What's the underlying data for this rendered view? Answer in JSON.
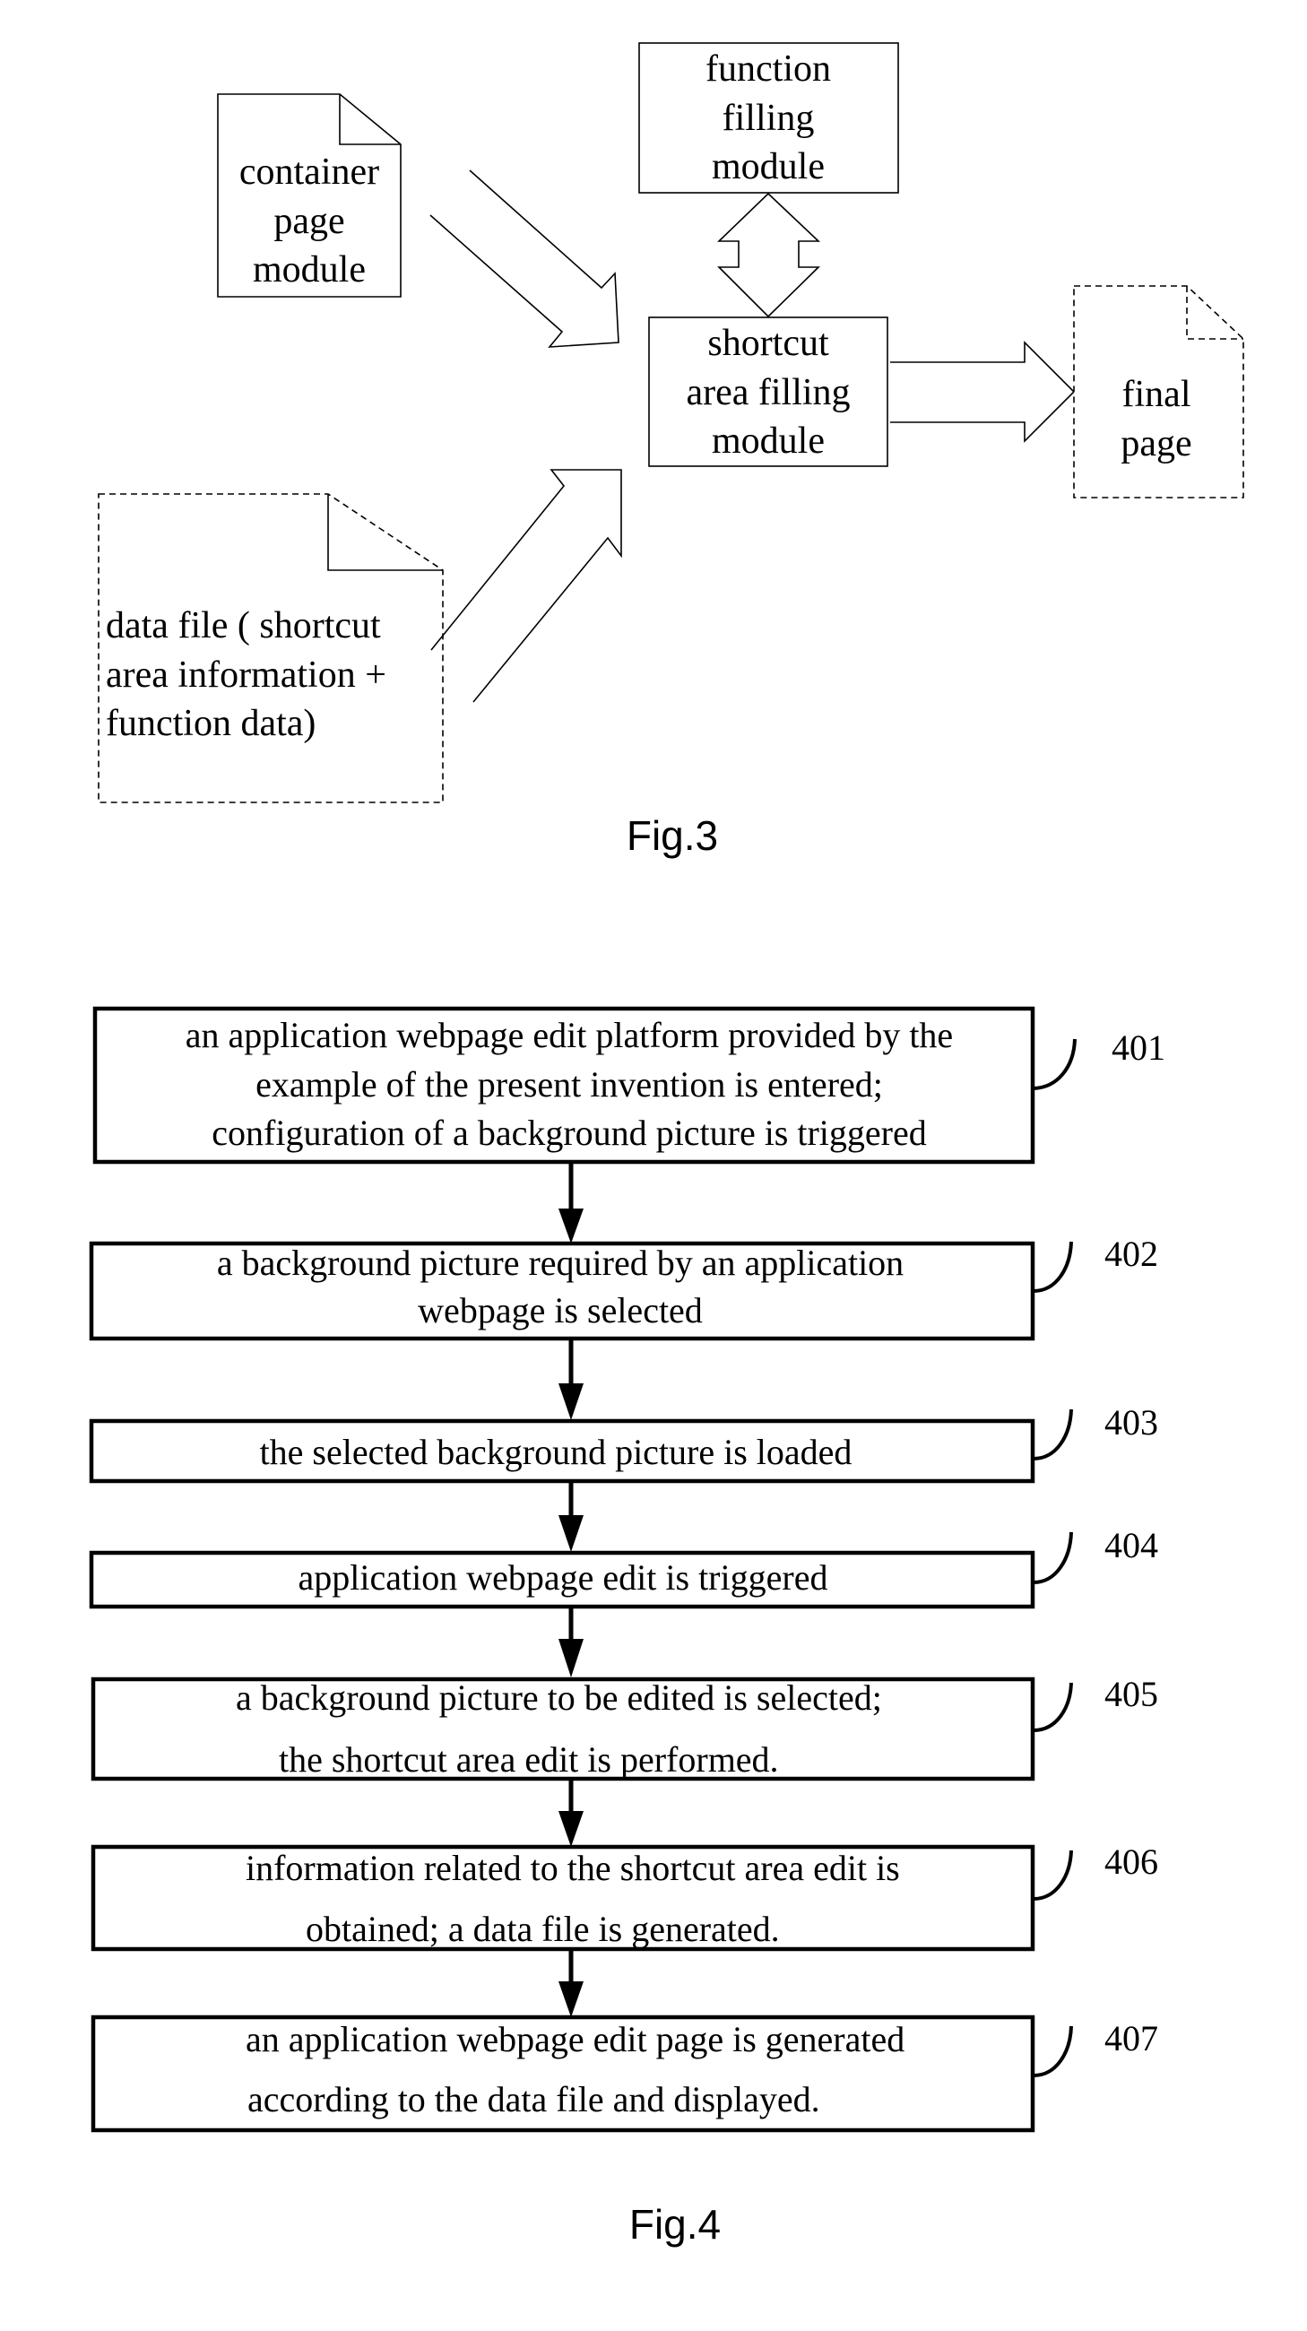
{
  "fig3": {
    "caption": "Fig.3",
    "nodes": {
      "container_page_module": {
        "lines": [
          "container",
          "page",
          "module"
        ],
        "shape": "document",
        "border": "solid"
      },
      "function_filling_module": {
        "lines": [
          "function",
          "filling",
          "module"
        ],
        "shape": "box",
        "border": "solid"
      },
      "shortcut_area_filling_module": {
        "lines": [
          "shortcut",
          "area filling",
          "module"
        ],
        "shape": "box",
        "border": "solid"
      },
      "final_page": {
        "lines": [
          "final",
          "page"
        ],
        "shape": "document",
        "border": "dashed"
      },
      "data_file": {
        "lines": [
          "data file ( shortcut",
          "area information +",
          "function data)"
        ],
        "shape": "document",
        "border": "dashed"
      }
    },
    "edges": [
      {
        "from": "container_page_module",
        "to": "shortcut_area_filling_module",
        "type": "block-arrow"
      },
      {
        "from": "data_file",
        "to": "shortcut_area_filling_module",
        "type": "block-arrow"
      },
      {
        "from": "function_filling_module",
        "to": "shortcut_area_filling_module",
        "type": "double-block-arrow"
      },
      {
        "from": "shortcut_area_filling_module",
        "to": "final_page",
        "type": "block-arrow"
      }
    ]
  },
  "fig4": {
    "caption": "Fig.4",
    "steps": [
      {
        "ref": "401",
        "lines": [
          "an application webpage edit platform provided by the",
          "example of the present invention is entered;",
          "configuration of a background picture is triggered"
        ]
      },
      {
        "ref": "402",
        "lines": [
          "a background picture required by an application",
          "webpage is selected"
        ]
      },
      {
        "ref": "403",
        "lines": [
          "the selected background picture is loaded"
        ]
      },
      {
        "ref": "404",
        "lines": [
          "application webpage edit is triggered"
        ]
      },
      {
        "ref": "405",
        "lines": [
          "a background picture to be edited is selected;",
          "the shortcut area edit is performed."
        ]
      },
      {
        "ref": "406",
        "lines": [
          "information related to the shortcut area edit is",
          "obtained; a data file is generated."
        ]
      },
      {
        "ref": "407",
        "lines": [
          "an application webpage edit page is generated",
          "according to the data file and displayed."
        ]
      }
    ]
  }
}
